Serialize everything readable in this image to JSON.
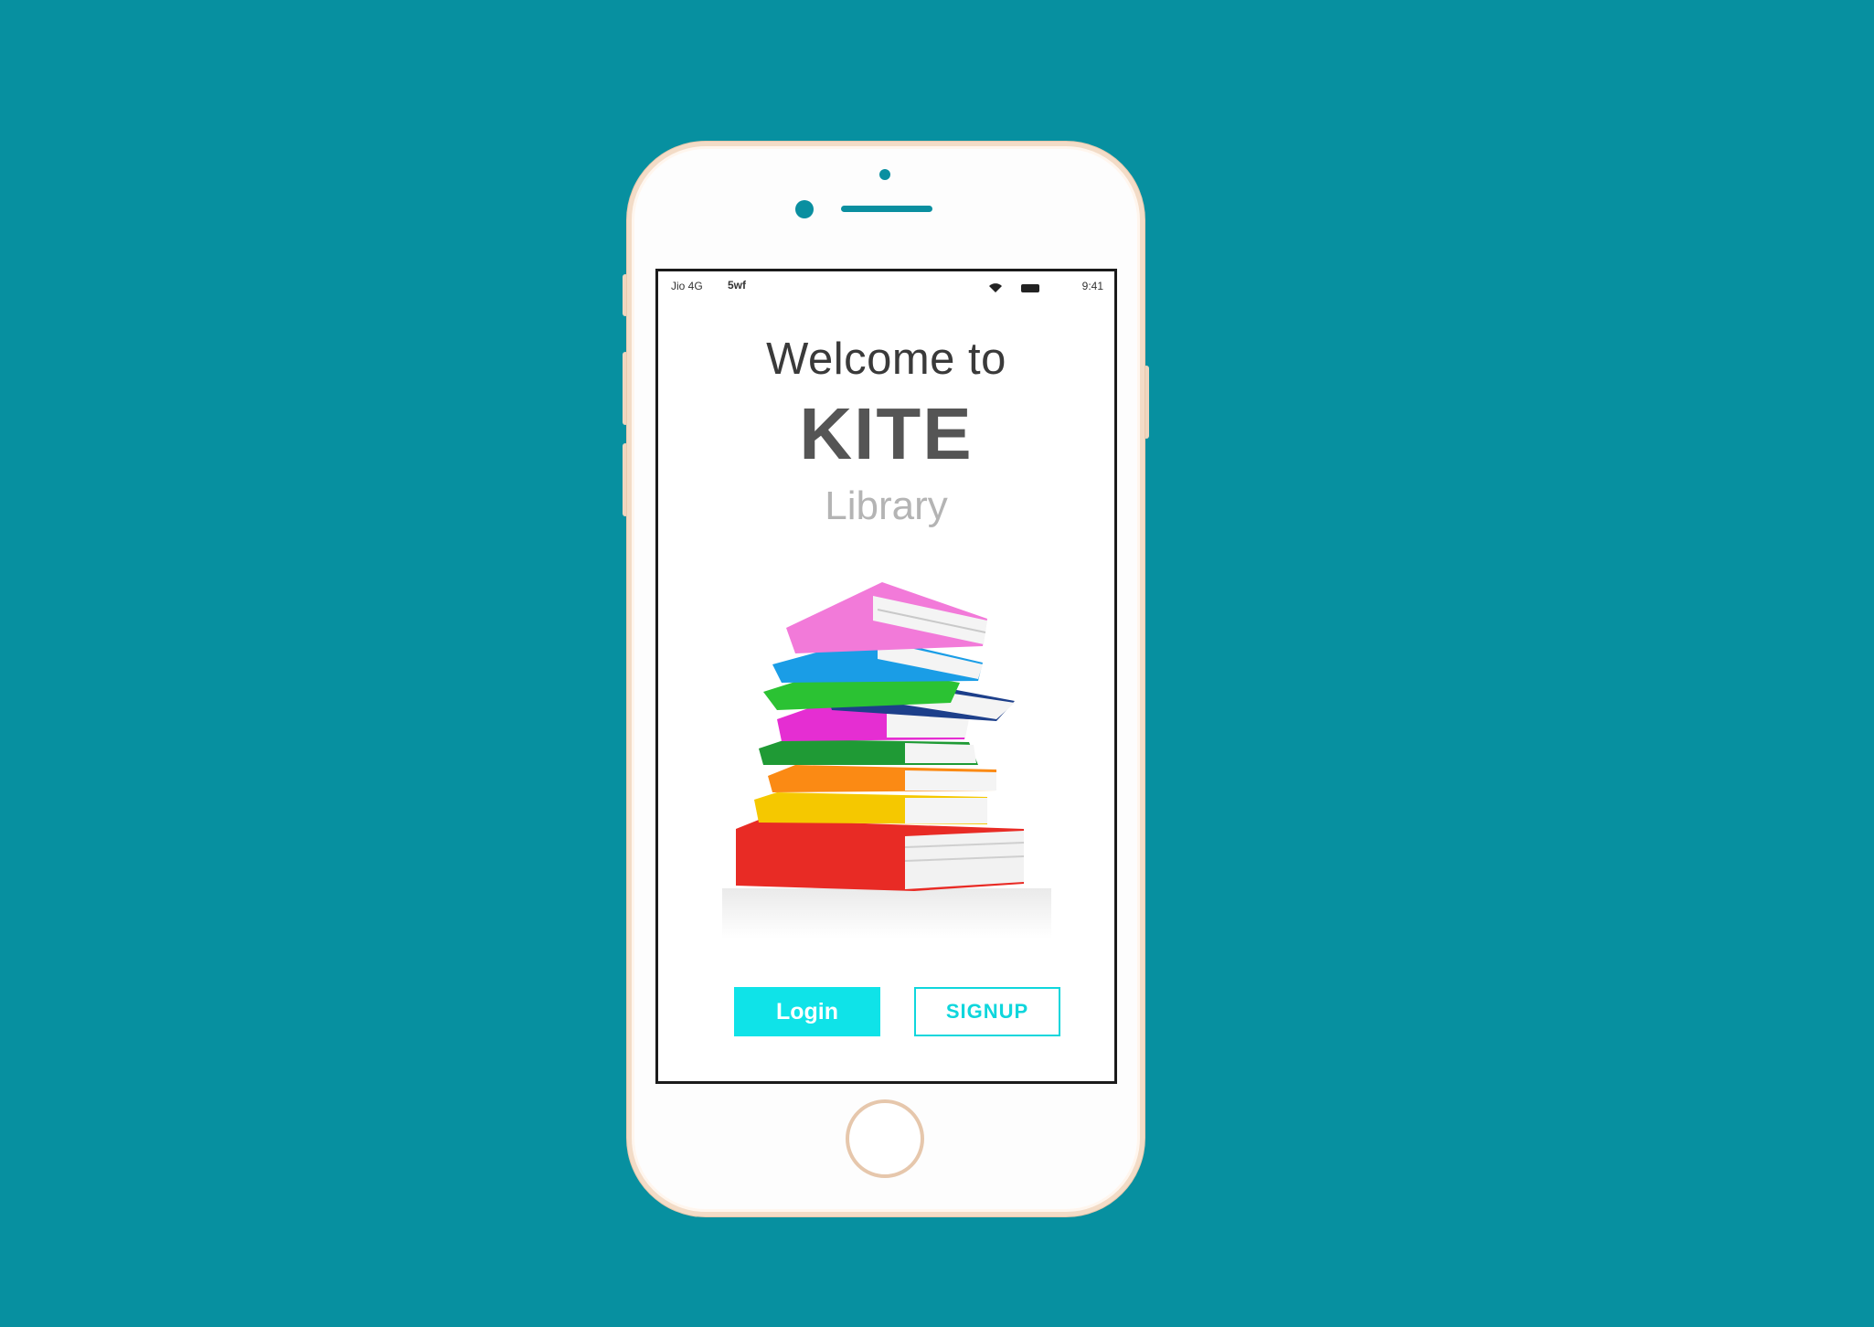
{
  "status_bar": {
    "carrier": "Jio 4G",
    "network": "5wf",
    "time": "9:41"
  },
  "welcome": {
    "line1": "Welcome to",
    "brand": "KITE",
    "line3": "Library"
  },
  "actions": {
    "login_label": "Login",
    "signup_label": "SIGNUP"
  },
  "colors": {
    "background": "#0790a0",
    "accent": "#0fe3e8",
    "phone_trim": "#f3dcc7"
  },
  "icons": [
    "wifi-icon",
    "battery-icon",
    "home-button-icon",
    "front-camera-icon",
    "speaker-icon"
  ]
}
